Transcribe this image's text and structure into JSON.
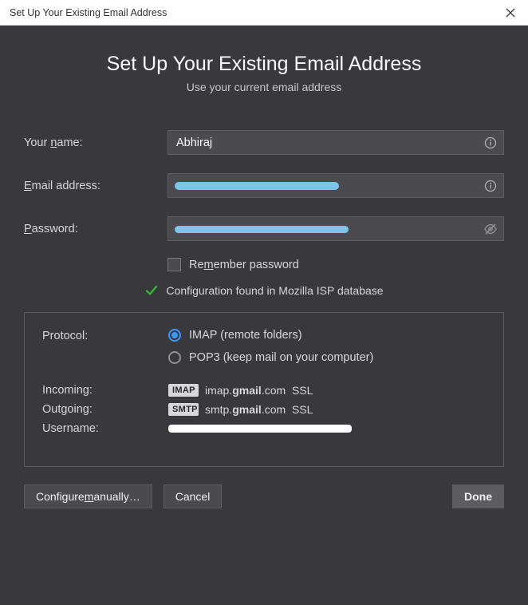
{
  "titlebar": {
    "title": "Set Up Your Existing Email Address"
  },
  "heading": {
    "title": "Set Up Your Existing Email Address",
    "subtitle": "Use your current email address"
  },
  "form": {
    "name_label_pre": "Your ",
    "name_label_u": "n",
    "name_label_post": "ame:",
    "name_value": "Abhiraj",
    "email_label_u": "E",
    "email_label_post": "mail address:",
    "password_label_u": "P",
    "password_label_post": "assword:",
    "remember_pre": "Re",
    "remember_u": "m",
    "remember_post": "ember password"
  },
  "status": {
    "message": "Configuration found in Mozilla ISP database"
  },
  "config": {
    "protocol_label": "Protocol:",
    "imap_label": "IMAP (remote folders)",
    "pop3_label": "POP3 (keep mail on your computer)",
    "incoming_label": "Incoming:",
    "outgoing_label": "Outgoing:",
    "username_label": "Username:",
    "incoming": {
      "badge": "IMAP",
      "prefix": "imap.",
      "domain": "gmail",
      "suffix": ".com",
      "sec": "SSL"
    },
    "outgoing": {
      "badge": "SMTP",
      "prefix": "smtp.",
      "domain": "gmail",
      "suffix": ".com",
      "sec": "SSL"
    }
  },
  "buttons": {
    "configure_pre": "Configure ",
    "configure_u": "m",
    "configure_post": "anually…",
    "cancel": "Cancel",
    "done": "Done"
  }
}
